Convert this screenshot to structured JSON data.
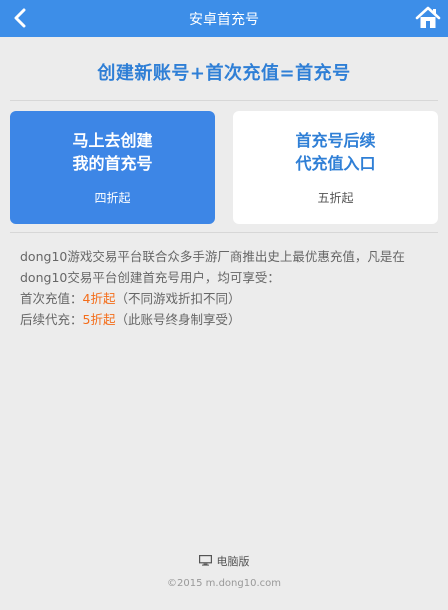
{
  "header": {
    "title": "安卓首充号",
    "back_icon": "chevron-left-icon",
    "home_icon": "home-icon"
  },
  "headline": "创建新账号+首次充值=首充号",
  "cards": [
    {
      "title_line1": "马上去创建",
      "title_line2": "我的首充号",
      "discount": "四折起"
    },
    {
      "title_line1": "首充号后续",
      "title_line2": "代充值入口",
      "discount": "五折起"
    }
  ],
  "description": {
    "intro": "dong10游戏交易平台联合众多手游厂商推出史上最优惠充值，凡是在dong10交易平台创建首充号用户，均可享受：",
    "first_label": "首次充值：",
    "first_value": "4折起",
    "first_note": "（不同游戏折扣不同）",
    "follow_label": "后续代充：",
    "follow_value": "5折起",
    "follow_note": "（此账号终身制享受）"
  },
  "footer": {
    "desktop_label": "电脑版",
    "desktop_icon": "monitor-icon",
    "copyright": "©2015 m.dong10.com"
  },
  "colors": {
    "header_bg": "#3d8ee8",
    "headline": "#2f7fd6",
    "highlight": "#f46d1a",
    "page_bg": "#ececec"
  }
}
